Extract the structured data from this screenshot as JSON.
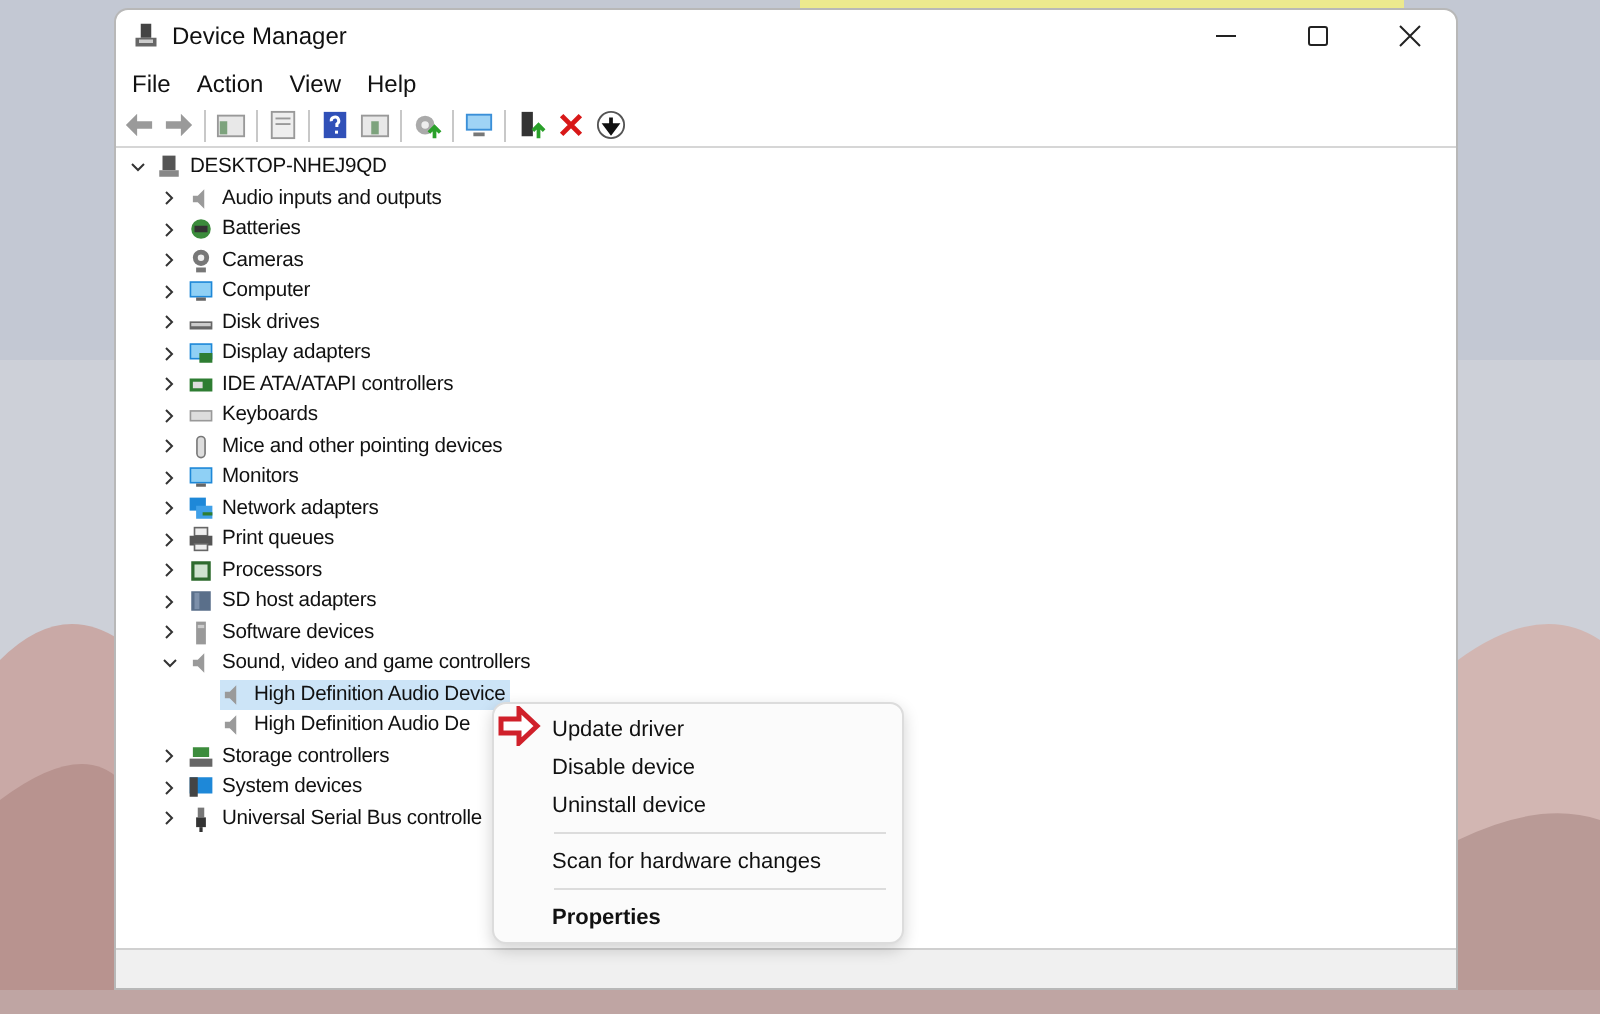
{
  "window": {
    "title": "Device Manager"
  },
  "menu_bar": [
    "File",
    "Action",
    "View",
    "Help"
  ],
  "tree": {
    "label": "DESKTOP-NHEJ9QD",
    "expanded": true,
    "selected": false,
    "children": [
      {
        "label": "Audio inputs and outputs",
        "expanded": false,
        "selected": false
      },
      {
        "label": "Batteries",
        "expanded": false,
        "selected": false
      },
      {
        "label": "Cameras",
        "expanded": false,
        "selected": false
      },
      {
        "label": "Computer",
        "expanded": false,
        "selected": false
      },
      {
        "label": "Disk drives",
        "expanded": false,
        "selected": false
      },
      {
        "label": "Display adapters",
        "expanded": false,
        "selected": false
      },
      {
        "label": "IDE ATA/ATAPI controllers",
        "expanded": false,
        "selected": false
      },
      {
        "label": "Keyboards",
        "expanded": false,
        "selected": false
      },
      {
        "label": "Mice and other pointing devices",
        "expanded": false,
        "selected": false
      },
      {
        "label": "Monitors",
        "expanded": false,
        "selected": false
      },
      {
        "label": "Network adapters",
        "expanded": false,
        "selected": false
      },
      {
        "label": "Print queues",
        "expanded": false,
        "selected": false
      },
      {
        "label": "Processors",
        "expanded": false,
        "selected": false
      },
      {
        "label": "SD host adapters",
        "expanded": false,
        "selected": false
      },
      {
        "label": "Software devices",
        "expanded": false,
        "selected": false
      },
      {
        "label": "Sound, video and game controllers",
        "expanded": true,
        "selected": false,
        "children": [
          {
            "label": "High Definition Audio Device",
            "selected": true
          },
          {
            "label": "High Definition Audio De",
            "selected": false
          }
        ]
      },
      {
        "label": "Storage controllers",
        "expanded": false,
        "selected": false
      },
      {
        "label": "System devices",
        "expanded": false,
        "selected": false
      },
      {
        "label": "Universal Serial Bus controlle",
        "expanded": false,
        "selected": false
      }
    ]
  },
  "context_menu": {
    "groups": [
      [
        {
          "label": "Update driver",
          "default": false
        },
        {
          "label": "Disable device",
          "default": false
        },
        {
          "label": "Uninstall device",
          "default": false
        }
      ],
      [
        {
          "label": "Scan for hardware changes",
          "default": false
        }
      ],
      [
        {
          "label": "Properties",
          "default": true
        }
      ]
    ]
  }
}
